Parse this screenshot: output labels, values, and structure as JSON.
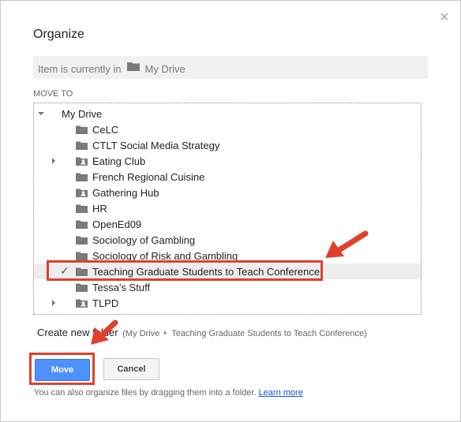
{
  "dialog": {
    "title": "Organize",
    "close_glyph": "×",
    "current_location": {
      "prefix": "Item is currently in",
      "folder": "My Drive",
      "icon": "folder-icon"
    },
    "move_to_label": "MOVE TO",
    "tree": [
      {
        "label": "My Drive",
        "expander": "expanded",
        "icon": "",
        "selected": false
      },
      {
        "label": "CeLC",
        "expander": "",
        "icon": "folder-icon",
        "selected": false
      },
      {
        "label": "CTLT Social Media Strategy",
        "expander": "",
        "icon": "folder-icon",
        "selected": false
      },
      {
        "label": "Eating Club",
        "expander": "collapsed",
        "icon": "shared-folder-icon",
        "selected": false
      },
      {
        "label": "French Regional Cuisine",
        "expander": "",
        "icon": "folder-icon",
        "selected": false
      },
      {
        "label": "Gathering Hub",
        "expander": "",
        "icon": "shared-folder-icon",
        "selected": false
      },
      {
        "label": "HR",
        "expander": "",
        "icon": "folder-icon",
        "selected": false
      },
      {
        "label": "OpenEd09",
        "expander": "",
        "icon": "folder-icon",
        "selected": false
      },
      {
        "label": "Sociology of Gambling",
        "expander": "",
        "icon": "folder-icon",
        "selected": false
      },
      {
        "label": "Sociology of Risk and Gambling",
        "expander": "",
        "icon": "folder-icon",
        "selected": false
      },
      {
        "label": "Teaching Graduate Students to Teach Conference",
        "expander": "",
        "icon": "folder-icon",
        "selected": true
      },
      {
        "label": "Tessa's Stuff",
        "expander": "",
        "icon": "folder-icon",
        "selected": false
      },
      {
        "label": "TLPD",
        "expander": "collapsed",
        "icon": "shared-folder-icon",
        "selected": false
      }
    ],
    "create_new_folder": {
      "label": "Create new folder",
      "open_paren": "(",
      "crumbs": [
        "My Drive",
        "Teaching Graduate Students to Teach Conference"
      ],
      "close_paren": ")"
    },
    "buttons": {
      "move": "Move",
      "cancel": "Cancel"
    },
    "hint": {
      "text": "You can also organize files by dragging them into a folder.",
      "link": "Learn more"
    },
    "colors": {
      "primary": "#4d90fe",
      "annotation": "#e0402c",
      "link": "#1155cc"
    }
  }
}
